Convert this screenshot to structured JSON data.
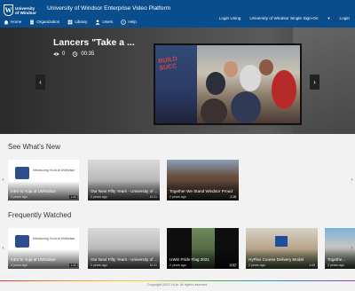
{
  "header": {
    "logo_line1": "University",
    "logo_line2": "of Windsor",
    "title": "University of Windsor Enterprise Video Platform",
    "nav": [
      {
        "label": "Home",
        "icon": "home-icon"
      },
      {
        "label": "Organization",
        "icon": "building-icon"
      },
      {
        "label": "Library",
        "icon": "grid-icon"
      },
      {
        "label": "Users",
        "icon": "user-icon"
      },
      {
        "label": "Help",
        "icon": "help-icon"
      }
    ],
    "login_using": "Login Using",
    "sso": "University of Windsor Single Sign-On",
    "login": "Login"
  },
  "hero": {
    "title": "Lancers \"Take a ...",
    "views": "0",
    "duration": "00:35",
    "sign_text": "BUILD SUCC"
  },
  "sections": {
    "new_title": "See What's New",
    "frequent_title": "Frequently Watched"
  },
  "new_cards": [
    {
      "title": "Intro to Yuja at UWindsor",
      "age": "4 years ago",
      "duration": "1:42",
      "thumb_text": "Introducing YuJa at UWindsor"
    },
    {
      "title": "Our Next Fifty Years - University of ...",
      "age": "2 years ago",
      "duration": "10:31"
    },
    {
      "title": "Together We Stand Windsor Proud",
      "age": "2 years ago",
      "duration": "1:18"
    }
  ],
  "freq_cards": [
    {
      "title": "Intro to Yuja at UWindsor",
      "age": "4 years ago",
      "duration": "1:42",
      "thumb_text": "Introducing YuJa at UWindsor"
    },
    {
      "title": "Our Next Fifty Years - University of ...",
      "age": "2 years ago",
      "duration": "10:31"
    },
    {
      "title": "UWin Pride Flag 2021",
      "age": "2 years ago",
      "duration": "0:57"
    },
    {
      "title": "HyFlex Course Delivery Model",
      "age": "2 years ago",
      "duration": "2:09"
    },
    {
      "title": "Togethe...",
      "age": "2 years ago"
    }
  ],
  "footer": {
    "copyright": "Copyright 2023 YuJa. All rights reserved."
  },
  "colors": {
    "header_bg": "#0a4d8c",
    "hero_bg": "#3d3d3d",
    "page_bg": "#f2f2f2"
  }
}
